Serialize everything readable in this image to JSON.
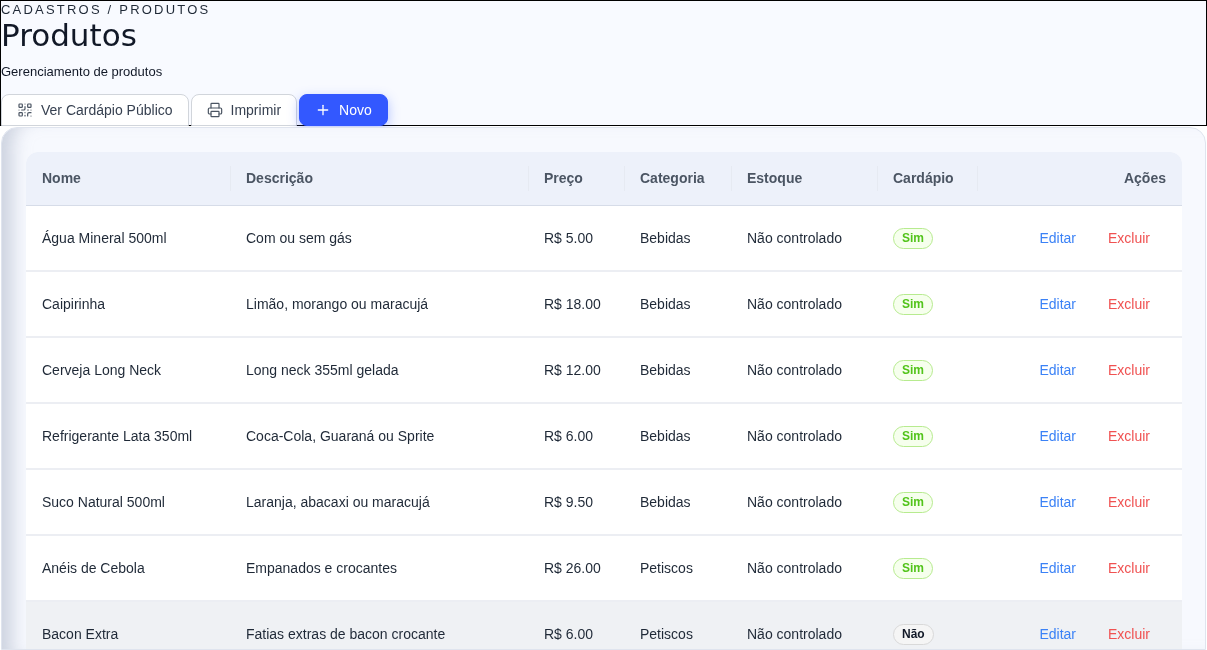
{
  "breadcrumb": "CADASTROS / PRODUTOS",
  "title": "Produtos",
  "subtitle": "Gerenciamento de produtos",
  "toolbar": [
    {
      "label": "Ver Cardápio Público",
      "kind": "qr"
    },
    {
      "label": "Imprimir",
      "kind": "print"
    },
    {
      "label": "Novo",
      "kind": "primary"
    }
  ],
  "table": {
    "columns": [
      "Nome",
      "Descrição",
      "Preço",
      "Categoria",
      "Estoque",
      "Cardápio",
      "Ações"
    ],
    "rows": [
      {
        "name": "Água Mineral 500ml",
        "description": "Com ou sem gás",
        "price": "R$ 5.00",
        "category": "Bebidas",
        "stock": "Não controlado",
        "menu": {
          "label": "Sim",
          "active": true
        },
        "actions": [
          {
            "label": "Editar",
            "kind": "edit"
          },
          {
            "label": "Excluir",
            "kind": "delete"
          }
        ],
        "hovered": false
      },
      {
        "name": "Caipirinha",
        "description": "Limão, morango ou maracujá",
        "price": "R$ 18.00",
        "category": "Bebidas",
        "stock": "Não controlado",
        "menu": {
          "label": "Sim",
          "active": true
        },
        "actions": [
          {
            "label": "Editar",
            "kind": "edit"
          },
          {
            "label": "Excluir",
            "kind": "delete"
          }
        ],
        "hovered": false
      },
      {
        "name": "Cerveja Long Neck",
        "description": "Long neck 355ml gelada",
        "price": "R$ 12.00",
        "category": "Bebidas",
        "stock": "Não controlado",
        "menu": {
          "label": "Sim",
          "active": true
        },
        "actions": [
          {
            "label": "Editar",
            "kind": "edit"
          },
          {
            "label": "Excluir",
            "kind": "delete"
          }
        ],
        "hovered": false
      },
      {
        "name": "Refrigerante Lata 350ml",
        "description": "Coca-Cola, Guaraná ou Sprite",
        "price": "R$ 6.00",
        "category": "Bebidas",
        "stock": "Não controlado",
        "menu": {
          "label": "Sim",
          "active": true
        },
        "actions": [
          {
            "label": "Editar",
            "kind": "edit"
          },
          {
            "label": "Excluir",
            "kind": "delete"
          }
        ],
        "hovered": false
      },
      {
        "name": "Suco Natural 500ml",
        "description": "Laranja, abacaxi ou maracujá",
        "price": "R$ 9.50",
        "category": "Bebidas",
        "stock": "Não controlado",
        "menu": {
          "label": "Sim",
          "active": true
        },
        "actions": [
          {
            "label": "Editar",
            "kind": "edit"
          },
          {
            "label": "Excluir",
            "kind": "delete"
          }
        ],
        "hovered": false
      },
      {
        "name": "Anéis de Cebola",
        "description": "Empanados e crocantes",
        "price": "R$ 26.00",
        "category": "Petiscos",
        "stock": "Não controlado",
        "menu": {
          "label": "Sim",
          "active": true
        },
        "actions": [
          {
            "label": "Editar",
            "kind": "edit"
          },
          {
            "label": "Excluir",
            "kind": "delete"
          }
        ],
        "hovered": false
      },
      {
        "name": "Bacon Extra",
        "description": "Fatias extras de bacon crocante",
        "price": "R$ 6.00",
        "category": "Petiscos",
        "stock": "Não controlado",
        "menu": {
          "label": "Não",
          "active": false
        },
        "actions": [
          {
            "label": "Editar",
            "kind": "edit"
          },
          {
            "label": "Excluir",
            "kind": "delete"
          }
        ],
        "hovered": true
      }
    ]
  }
}
